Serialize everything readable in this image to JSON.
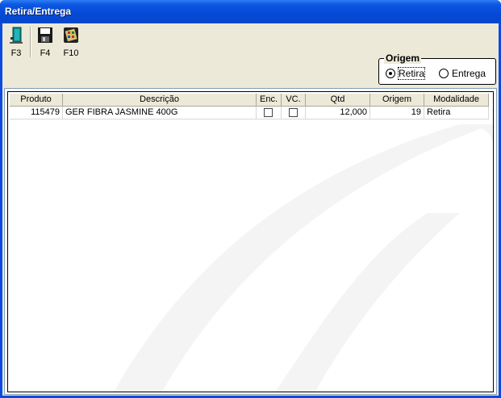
{
  "window": {
    "title": "Retira/Entrega"
  },
  "toolbar": {
    "buttons": [
      {
        "key": "F3",
        "icon": "exit-door-icon"
      },
      {
        "key": "F4",
        "icon": "floppy-disk-save-icon"
      },
      {
        "key": "F10",
        "icon": "calculator-icon"
      }
    ]
  },
  "origem": {
    "title": "Origem",
    "options": [
      {
        "label": "Retira",
        "checked": true
      },
      {
        "label": "Entrega",
        "checked": false
      }
    ]
  },
  "grid": {
    "columns": [
      "Produto",
      "Descrição",
      "Enc.",
      "VC.",
      "Qtd",
      "Origem",
      "Modalidade"
    ],
    "rows": [
      {
        "produto": "115479",
        "descricao": "GER FIBRA JASMINE 400G",
        "enc": false,
        "vc": false,
        "qtd": "12,000",
        "origem": "19",
        "modalidade": "Retira"
      }
    ]
  },
  "colors": {
    "titlebar": "#0548d8",
    "client": "#ece9d8",
    "border": "#7f9db9"
  }
}
